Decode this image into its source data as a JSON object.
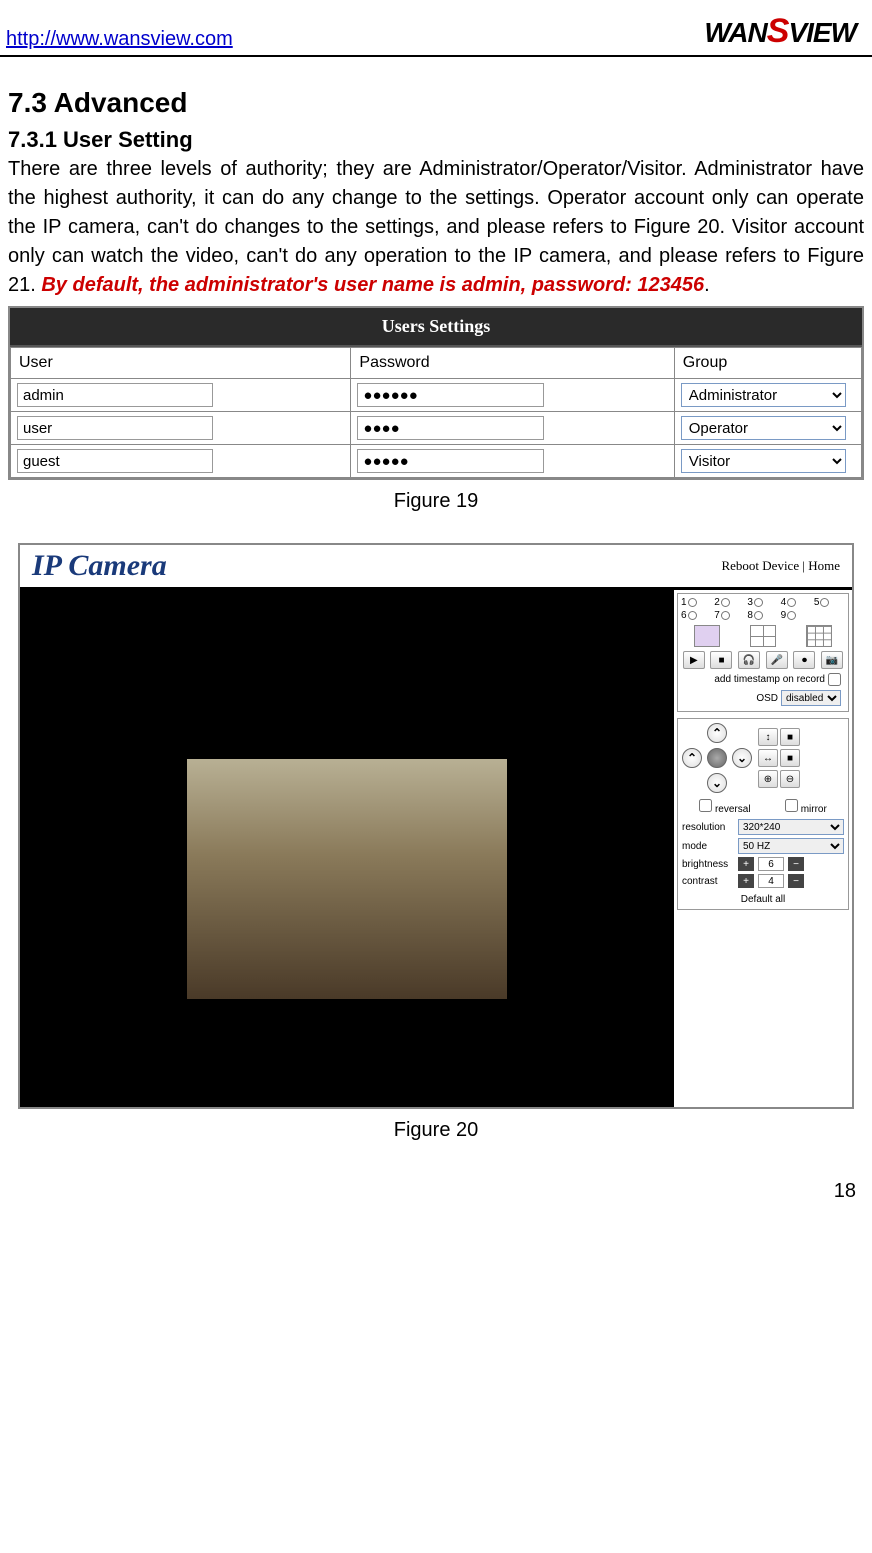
{
  "header": {
    "link": "http://www.wansview.com",
    "logo_pre": "WAN",
    "logo_s": "S",
    "logo_post": "VIEW"
  },
  "section": {
    "h2": "7.3  Advanced",
    "h3": "7.3.1  User Setting",
    "body_pre": "There are three levels of authority; they are Administrator/Operator/Visitor. Administrator have the highest authority, it can do any change to the settings. Operator account only can operate the IP camera, can't do changes to the settings, and please refers to Figure 20. Visitor account only can watch the video, can't do any operation to the IP camera, and please refers to Figure 21. ",
    "warning": "By default, the administrator's user name is admin, password: 123456",
    "body_post": "."
  },
  "fig19": {
    "title": "Users  Settings",
    "headers": {
      "user": "User",
      "password": "Password",
      "group": "Group"
    },
    "rows": [
      {
        "user": "admin",
        "password": "●●●●●●",
        "group": "Administrator"
      },
      {
        "user": "user",
        "password": "●●●●",
        "group": "Operator"
      },
      {
        "user": "guest",
        "password": "●●●●●",
        "group": "Visitor"
      }
    ],
    "caption": "Figure 19"
  },
  "fig20": {
    "logo": "IP Camera",
    "link_reboot": "Reboot Device",
    "link_sep": " | ",
    "link_home": "Home",
    "presets": [
      "1",
      "2",
      "3",
      "4",
      "5",
      "6",
      "7",
      "8",
      "9"
    ],
    "timestamp_label": "add timestamp on record",
    "osd_label": "OSD",
    "osd_value": "disabled",
    "reversal_label": "reversal",
    "mirror_label": "mirror",
    "resolution_label": "resolution",
    "resolution_value": "320*240",
    "mode_label": "mode",
    "mode_value": "50 HZ",
    "brightness_label": "brightness",
    "brightness_value": "6",
    "contrast_label": "contrast",
    "contrast_value": "4",
    "default_label": "Default all",
    "caption": "Figure 20"
  },
  "page_number": "18"
}
